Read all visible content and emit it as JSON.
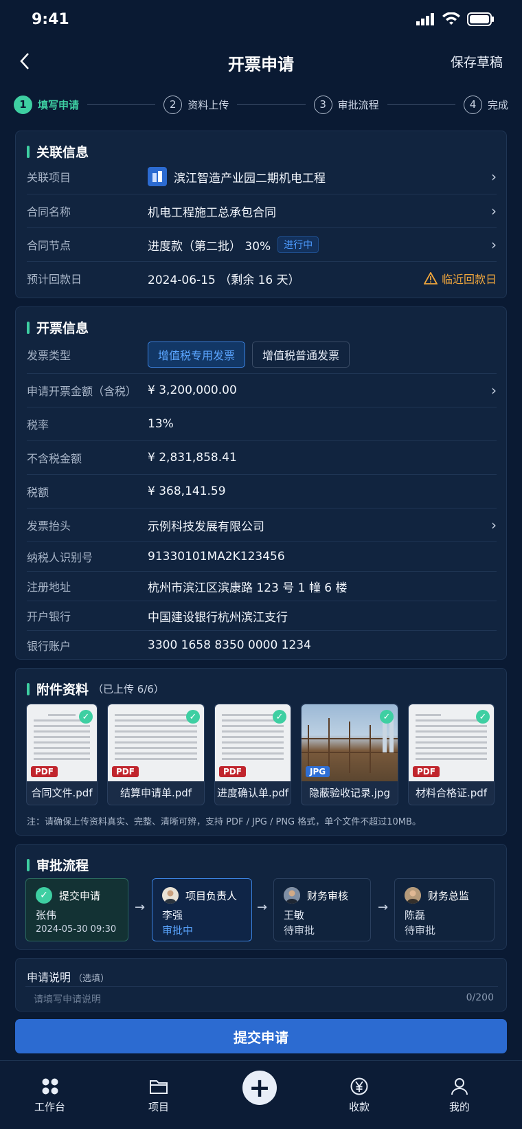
{
  "status": {
    "time": "9:41"
  },
  "nav": {
    "title": "开票申请",
    "save_draft": "保存草稿"
  },
  "steps": [
    {
      "num": "1",
      "label": "填写申请"
    },
    {
      "num": "2",
      "label": "资料上传"
    },
    {
      "num": "3",
      "label": "审批流程"
    },
    {
      "num": "4",
      "label": "完成"
    }
  ],
  "related": {
    "title": "关联信息",
    "project_label": "关联项目",
    "project_value": "滨江智造产业园二期机电工程",
    "contract_label": "合同名称",
    "contract_value": "机电工程施工总承包合同",
    "node_label": "合同节点",
    "node_value": "进度款（第二批） 30%",
    "node_tag": "进行中",
    "date_label": "预计回款日",
    "date_value": "2024-06-15 （剩余 16 天）",
    "date_warn": "临近回款日"
  },
  "invoice": {
    "title": "开票信息",
    "type_label": "发票类型",
    "type_options": [
      "增值税专用发票",
      "增值税普通发票"
    ],
    "amount_label": "申请开票金额（含税）",
    "amount_value": "¥  3,200,000.00",
    "rate_label": "税率",
    "rate_value": "13%",
    "net_label": "不含税金额",
    "net_value": "¥  2,831,858.41",
    "tax_label": "税额",
    "tax_value": "¥  368,141.59",
    "header_label": "发票抬头",
    "header_value": "示例科技发展有限公司",
    "taxid_label": "纳税人识别号",
    "taxid_value": "91330101MA2K123456",
    "addr_label": "注册地址",
    "addr_value": "杭州市滨江区滨康路 123 号 1 幢 6 楼",
    "bank_label": "开户银行",
    "bank_value": "中国建设银行杭州滨江支行",
    "account_label": "银行账户",
    "account_value": "3300 1658 8350 0000 1234"
  },
  "attachments": {
    "title": "附件资料",
    "count": "（已上传 6/6）",
    "files": [
      {
        "name": "合同文件.pdf",
        "type": "PDF"
      },
      {
        "name": "结算申请单.pdf",
        "type": "PDF"
      },
      {
        "name": "进度确认单.pdf",
        "type": "PDF"
      },
      {
        "name": "隐蔽验收记录.jpg",
        "type": "JPG"
      },
      {
        "name": "材料合格证.pdf",
        "type": "PDF"
      }
    ],
    "note": "注：请确保上传资料真实、完整、清晰可辨，支持 PDF / JPG / PNG 格式，单个文件不超过10MB。"
  },
  "approval": {
    "title": "审批流程",
    "nodes": [
      {
        "role": "提交申请",
        "name": "张伟",
        "status": "2024-05-30 09:30"
      },
      {
        "role": "项目负责人",
        "name": "李强",
        "status": "审批中"
      },
      {
        "role": "财务审核",
        "name": "王敏",
        "status": "待审批"
      },
      {
        "role": "财务总监",
        "name": "陈磊",
        "status": "待审批"
      }
    ]
  },
  "remark": {
    "label": "申请说明",
    "optional": "（选填）",
    "placeholder": "请填写申请说明",
    "counter": "0/200"
  },
  "submit_label": "提交申请",
  "tabs": [
    "工作台",
    "项目",
    "收款",
    "我的"
  ],
  "colors": {
    "accent": "#3ecfa2",
    "primary": "#2c6bd1",
    "warning": "#f0a63c",
    "background": "#0a1a33"
  }
}
